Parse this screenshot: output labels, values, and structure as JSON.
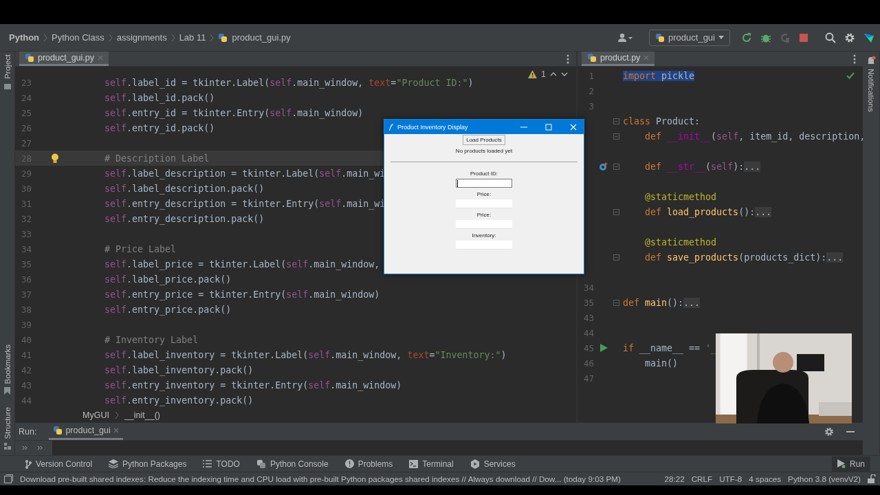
{
  "sidebar_left": {
    "top": [
      {
        "label": "Project"
      }
    ],
    "bottom": [
      {
        "label": "Bookmarks",
        "kind": "bookmarks"
      },
      {
        "label": "Structure",
        "kind": "structure"
      }
    ]
  },
  "navigation_bar": {
    "breadcrumbs": [
      {
        "label": "Python",
        "bold": true,
        "kind": "folder"
      },
      {
        "label": "Python Class",
        "bold": false,
        "kind": "folder"
      },
      {
        "label": "assignments",
        "bold": false,
        "kind": "folder"
      },
      {
        "label": "Lab 11",
        "bold": false,
        "kind": "folder"
      },
      {
        "label": "product_gui.py",
        "bold": false,
        "kind": "file"
      }
    ],
    "run_config": "product_gui"
  },
  "editors": [
    {
      "tab": {
        "label": "product_gui.py",
        "selected": true
      },
      "problems": "1",
      "lines": [
        {
          "number": "23",
          "current": false,
          "segments": [
            {
              "text": "        self",
              "kind": "s"
            },
            {
              "text": ".label_id = tkinter.Label(",
              "kind": "p"
            },
            {
              "text": "self",
              "kind": "s"
            },
            {
              "text": ".main_window, ",
              "kind": "p"
            },
            {
              "text": "text",
              "kind": "a"
            },
            {
              "text": "=",
              "kind": "p"
            },
            {
              "text": "\"Product ID:\"",
              "kind": "st"
            },
            {
              "text": ")",
              "kind": "p"
            }
          ]
        },
        {
          "number": "24",
          "current": false,
          "segments": [
            {
              "text": "        self",
              "kind": "s"
            },
            {
              "text": ".label_id.pack()",
              "kind": "p"
            }
          ]
        },
        {
          "number": "25",
          "current": false,
          "segments": [
            {
              "text": "        self",
              "kind": "s"
            },
            {
              "text": ".entry_id = tkinter.Entry(",
              "kind": "p"
            },
            {
              "text": "self",
              "kind": "s"
            },
            {
              "text": ".main_window)",
              "kind": "p"
            }
          ]
        },
        {
          "number": "26",
          "current": false,
          "segments": [
            {
              "text": "        self",
              "kind": "s"
            },
            {
              "text": ".entry_id.pack()",
              "kind": "p"
            }
          ]
        },
        {
          "number": "27",
          "current": false
        },
        {
          "number": "28",
          "current": true,
          "kind": "bulb",
          "segments": [
            {
              "text": "        # Description Label",
              "kind": "c"
            }
          ]
        },
        {
          "number": "29",
          "current": false,
          "segments": [
            {
              "text": "        self",
              "kind": "s"
            },
            {
              "text": ".label_description = tkinter.Label(",
              "kind": "p"
            },
            {
              "text": "self",
              "kind": "s"
            },
            {
              "text": ".main_wi",
              "kind": "p"
            }
          ]
        },
        {
          "number": "30",
          "current": false,
          "segments": [
            {
              "text": "        self",
              "kind": "s"
            },
            {
              "text": ".label_description.pack()",
              "kind": "p"
            }
          ]
        },
        {
          "number": "31",
          "current": false,
          "segments": [
            {
              "text": "        self",
              "kind": "s"
            },
            {
              "text": ".entry_description = tkinter.Entry(",
              "kind": "p"
            },
            {
              "text": "self",
              "kind": "s"
            },
            {
              "text": ".main_wi",
              "kind": "p"
            }
          ]
        },
        {
          "number": "32",
          "current": false,
          "segments": [
            {
              "text": "        self",
              "kind": "s"
            },
            {
              "text": ".entry_description.pack()",
              "kind": "p"
            }
          ]
        },
        {
          "number": "33",
          "current": false
        },
        {
          "number": "34",
          "current": false,
          "segments": [
            {
              "text": "        # Price Label",
              "kind": "c"
            }
          ]
        },
        {
          "number": "35",
          "current": false,
          "segments": [
            {
              "text": "        self",
              "kind": "s"
            },
            {
              "text": ".label_price = tkinter.Label(",
              "kind": "p"
            },
            {
              "text": "self",
              "kind": "s"
            },
            {
              "text": ".main_window,",
              "kind": "p"
            }
          ]
        },
        {
          "number": "36",
          "current": false,
          "segments": [
            {
              "text": "        self",
              "kind": "s"
            },
            {
              "text": ".label_price.pack()",
              "kind": "p"
            }
          ]
        },
        {
          "number": "37",
          "current": false,
          "segments": [
            {
              "text": "        self",
              "kind": "s"
            },
            {
              "text": ".entry_price = tkinter.Entry(",
              "kind": "p"
            },
            {
              "text": "self",
              "kind": "s"
            },
            {
              "text": ".main_window)",
              "kind": "p"
            }
          ]
        },
        {
          "number": "38",
          "current": false,
          "segments": [
            {
              "text": "        self",
              "kind": "s"
            },
            {
              "text": ".entry_price.pack()",
              "kind": "p"
            }
          ]
        },
        {
          "number": "39",
          "current": false
        },
        {
          "number": "40",
          "current": false,
          "segments": [
            {
              "text": "        # Inventory Label",
              "kind": "c"
            }
          ]
        },
        {
          "number": "41",
          "current": false,
          "segments": [
            {
              "text": "        self",
              "kind": "s"
            },
            {
              "text": ".label_inventory = tkinter.Label(",
              "kind": "p"
            },
            {
              "text": "self",
              "kind": "s"
            },
            {
              "text": ".main_window, ",
              "kind": "p"
            },
            {
              "text": "text",
              "kind": "a"
            },
            {
              "text": "=",
              "kind": "p"
            },
            {
              "text": "\"Inventory:\"",
              "kind": "st"
            },
            {
              "text": ")",
              "kind": "p"
            }
          ]
        },
        {
          "number": "42",
          "current": false,
          "segments": [
            {
              "text": "        self",
              "kind": "s"
            },
            {
              "text": ".label_inventory.pack()",
              "kind": "p"
            }
          ]
        },
        {
          "number": "43",
          "current": false,
          "segments": [
            {
              "text": "        self",
              "kind": "s"
            },
            {
              "text": ".entry_inventory = tkinter.Entry(",
              "kind": "p"
            },
            {
              "text": "self",
              "kind": "s"
            },
            {
              "text": ".main_window)",
              "kind": "p"
            }
          ]
        },
        {
          "number": "44",
          "current": false,
          "segments": [
            {
              "text": "        self",
              "kind": "s"
            },
            {
              "text": ".entry_inventory.pack()",
              "kind": "p"
            }
          ]
        }
      ],
      "breadcrumbs": [
        "MyGUI",
        "__init__()"
      ]
    },
    {
      "tab": {
        "label": "product.py",
        "selected": true
      },
      "lines": [
        {
          "number": "1",
          "current": false,
          "selected": true,
          "segments": [
            {
              "text": "import",
              "kind": "k"
            },
            {
              "text": " pickle",
              "kind": "p"
            }
          ]
        },
        {
          "number": "2",
          "current": false
        },
        {
          "number": "3",
          "current": false
        },
        {
          "current": false,
          "fold_marker": true,
          "segments": [
            {
              "text": "class ",
              "kind": "k"
            },
            {
              "text": "Product:",
              "kind": "p"
            }
          ]
        },
        {
          "current": false,
          "fold_marker": true,
          "segments": [
            {
              "text": "    def ",
              "kind": "k"
            },
            {
              "text": "__init__",
              "kind": "m"
            },
            {
              "text": "(",
              "kind": "p"
            },
            {
              "text": "self",
              "kind": "s"
            },
            {
              "text": ", item_id, description,",
              "kind": "p"
            }
          ]
        },
        {
          "current": false
        },
        {
          "current": false,
          "fold_marker": true,
          "kind": "override",
          "segments": [
            {
              "text": "    def ",
              "kind": "k"
            },
            {
              "text": "__str__",
              "kind": "m"
            },
            {
              "text": "(",
              "kind": "p"
            },
            {
              "text": "self",
              "kind": "s"
            },
            {
              "text": "):",
              "kind": "p"
            },
            {
              "text": "...",
              "kind": "fold"
            }
          ]
        },
        {
          "current": false
        },
        {
          "current": false,
          "segments": [
            {
              "text": "    @staticmethod",
              "kind": "d"
            }
          ]
        },
        {
          "current": false,
          "fold_marker": true,
          "segments": [
            {
              "text": "    def ",
              "kind": "k"
            },
            {
              "text": "load_products",
              "kind": "f"
            },
            {
              "text": "():",
              "kind": "p"
            },
            {
              "text": "...",
              "kind": "fold"
            }
          ]
        },
        {
          "current": false
        },
        {
          "current": false,
          "segments": [
            {
              "text": "    @staticmethod",
              "kind": "d"
            }
          ]
        },
        {
          "current": false,
          "fold_marker": true,
          "segments": [
            {
              "text": "    def ",
              "kind": "k"
            },
            {
              "text": "save_products",
              "kind": "f"
            },
            {
              "text": "(products_dict):",
              "kind": "p"
            },
            {
              "text": "...",
              "kind": "fold"
            }
          ]
        },
        {
          "current": false
        },
        {
          "number": "34",
          "current": false
        },
        {
          "number": "35",
          "current": false,
          "fold_marker": true,
          "segments": [
            {
              "text": "def ",
              "kind": "k"
            },
            {
              "text": "main",
              "kind": "f"
            },
            {
              "text": "():",
              "kind": "p"
            },
            {
              "text": "...",
              "kind": "fold"
            }
          ]
        },
        {
          "number": "43",
          "current": false
        },
        {
          "number": "44",
          "current": false
        },
        {
          "number": "45",
          "current": false,
          "kind": "run",
          "segments": [
            {
              "text": "if ",
              "kind": "k"
            },
            {
              "text": "__name__ == ",
              "kind": "p"
            },
            {
              "text": "'_",
              "kind": "st"
            }
          ]
        },
        {
          "number": "46",
          "current": false,
          "segments": [
            {
              "text": "    main()",
              "kind": "p"
            }
          ]
        },
        {
          "number": "47",
          "current": false
        }
      ]
    }
  ],
  "dialog": {
    "title": "Product Inventory Display",
    "button": "Load Products",
    "status": "No products loaded yet",
    "fields": [
      {
        "label": "Product ID:",
        "focused": true
      },
      {
        "label": "Price:",
        "focused": false
      },
      {
        "label": "Price:",
        "focused": false
      },
      {
        "label": "Inventory:",
        "focused": false
      }
    ]
  },
  "run_panel": {
    "label": "Run:",
    "tab": "product_gui"
  },
  "tool_windows": [
    {
      "label": "Version Control",
      "kind": "vcs"
    },
    {
      "label": "Python Packages",
      "kind": "packages"
    },
    {
      "label": "TODO",
      "kind": "todo"
    },
    {
      "label": "Python Console",
      "kind": "console"
    },
    {
      "label": "Problems",
      "kind": "problems"
    },
    {
      "label": "Terminal",
      "kind": "terminal"
    },
    {
      "label": "Services",
      "kind": "services"
    }
  ],
  "run_button": "Run",
  "status_bar": {
    "message": "Download pre-built shared indexes: Reduce the indexing time and CPU load with pre-built Python packages shared indexes // Always download // Dow... (today 9:03 PM)",
    "items": [
      "28:22",
      "CRLF",
      "UTF-8",
      "4 spaces",
      "Python 3.8 (venvV2)"
    ]
  },
  "sidebar_right": {
    "items": [
      {
        "label": "Notifications"
      }
    ]
  }
}
